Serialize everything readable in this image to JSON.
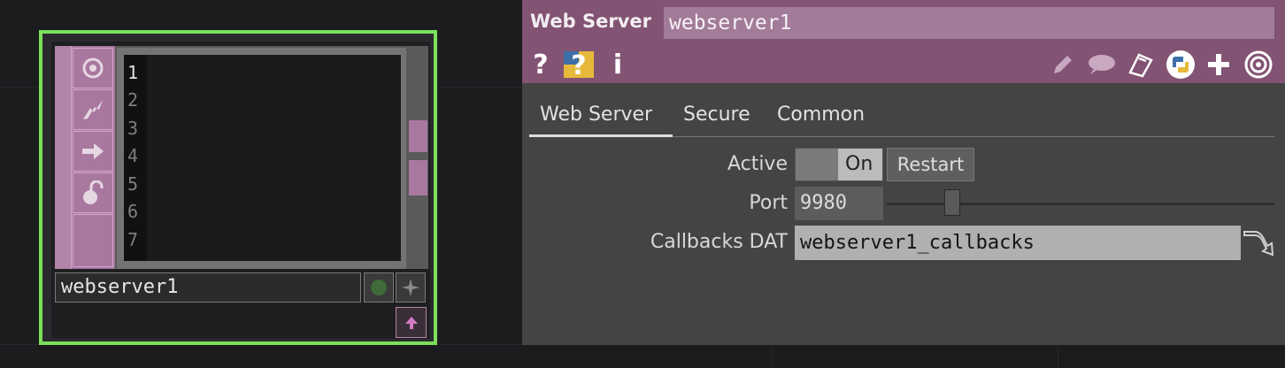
{
  "node": {
    "name": "webserver1",
    "line_numbers": [
      "1",
      "2",
      "3",
      "4",
      "5",
      "6",
      "7"
    ],
    "flag_icons": [
      "cook-flag-icon",
      "bypass-flag-icon",
      "display-flag-icon",
      "lock-flag-icon"
    ],
    "colors": {
      "selection": "#7be05a",
      "dat_accent": "#a8789f"
    }
  },
  "panel": {
    "op_type": "Web Server",
    "op_name": "webserver1",
    "header_icons": [
      "help-icon",
      "python-help-icon",
      "info-icon",
      "edit-icon",
      "comment-icon",
      "clipboard-icon",
      "python-icon",
      "add-icon",
      "viewer-target-icon"
    ],
    "tabs": [
      "Web Server",
      "Secure",
      "Common"
    ],
    "active_tab": "Web Server",
    "params": {
      "active": {
        "label": "Active",
        "value": "On",
        "restart_label": "Restart"
      },
      "port": {
        "label": "Port",
        "value": "9980",
        "slider_fraction": 0.17
      },
      "callbacks": {
        "label": "Callbacks DAT",
        "value": "webserver1_callbacks"
      }
    },
    "colors": {
      "header": "#835373",
      "body": "#444444"
    }
  }
}
